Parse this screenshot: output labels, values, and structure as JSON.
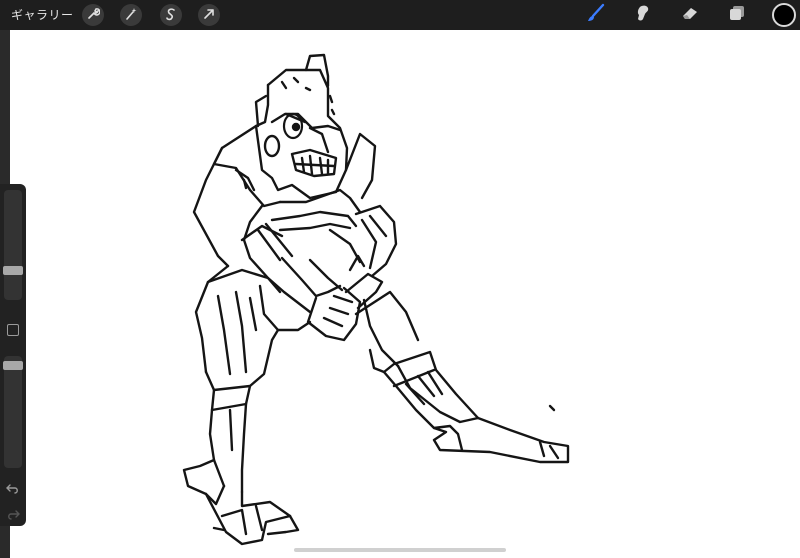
{
  "topbar": {
    "gallery_label": "ギャラリー",
    "left_tools": [
      {
        "name": "actions",
        "icon": "wrench-icon"
      },
      {
        "name": "adjustments",
        "icon": "magic-wand-icon"
      },
      {
        "name": "selection",
        "icon": "selection-s-icon"
      },
      {
        "name": "transform",
        "icon": "arrow-cursor-icon"
      }
    ],
    "right_tools": [
      {
        "name": "brush",
        "icon": "brush-icon",
        "active": true
      },
      {
        "name": "smudge",
        "icon": "smudge-icon"
      },
      {
        "name": "eraser",
        "icon": "eraser-icon"
      },
      {
        "name": "layers",
        "icon": "layers-icon"
      }
    ],
    "current_color": "#000000",
    "active_color": "#3b7cff"
  },
  "sidebar": {
    "brush_size_level": 0.25,
    "opacity_level": 0.95
  },
  "canvas": {
    "background": "#ffffff"
  }
}
